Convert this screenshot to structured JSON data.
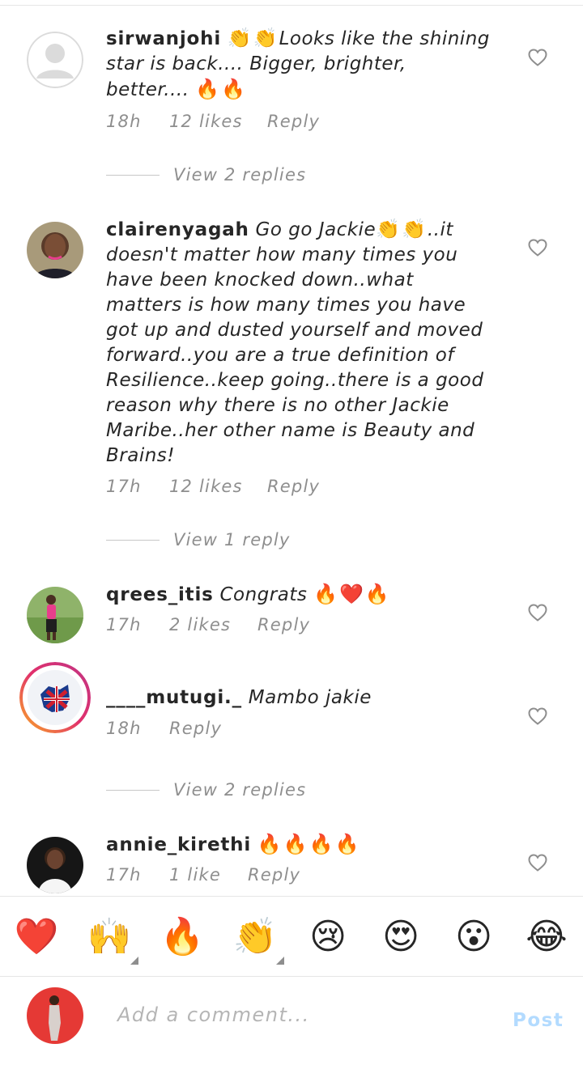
{
  "comments": [
    {
      "username": "sirwanjohi",
      "emoji_before": "👏👏",
      "text": "Looks like the shining star is back.... Bigger, brighter, better....",
      "emoji_after": "🔥🔥",
      "time": "18h",
      "likes": "12 likes",
      "reply": "Reply",
      "view_replies": "View 2 replies",
      "avatar": "default-avatar"
    },
    {
      "username": "clairenyagah",
      "text": "Go go Jackie",
      "emoji_mid": "👏👏",
      "text2": "..it doesn't matter how many times you have been knocked down..what matters is how many times you have got up and dusted yourself and moved forward..you are a true definition of Resilience..keep going..there is a good reason why there is no other Jackie Maribe..her other name is Beauty and Brains!",
      "time": "17h",
      "likes": "12 likes",
      "reply": "Reply",
      "view_replies": "View 1 reply",
      "avatar": "profile-photo"
    },
    {
      "username": "qrees_itis",
      "text": "Congrats",
      "emoji_after": "🔥❤️🔥",
      "time": "17h",
      "likes": "2 likes",
      "reply": "Reply",
      "avatar": "profile-photo"
    },
    {
      "username": "____mutugi._",
      "text": "Mambo jakie",
      "time": "18h",
      "reply": "Reply",
      "view_replies": "View 2 replies",
      "avatar": "story-ring-photo"
    },
    {
      "username": "annie_kirethi",
      "emoji_after": "🔥🔥🔥🔥",
      "time": "17h",
      "likes": "1 like",
      "reply": "Reply",
      "avatar": "profile-photo"
    }
  ],
  "emoji_bar": [
    "❤️",
    "🙌",
    "🔥",
    "👏",
    "😢",
    "😍",
    "😮",
    "😂"
  ],
  "composer": {
    "placeholder": "Add a comment...",
    "post_label": "Post"
  },
  "colors": {
    "meta_gray": "#8e8e8e",
    "post_disabled": "#b3dbff",
    "heart_outline": "#8e8e8e"
  }
}
